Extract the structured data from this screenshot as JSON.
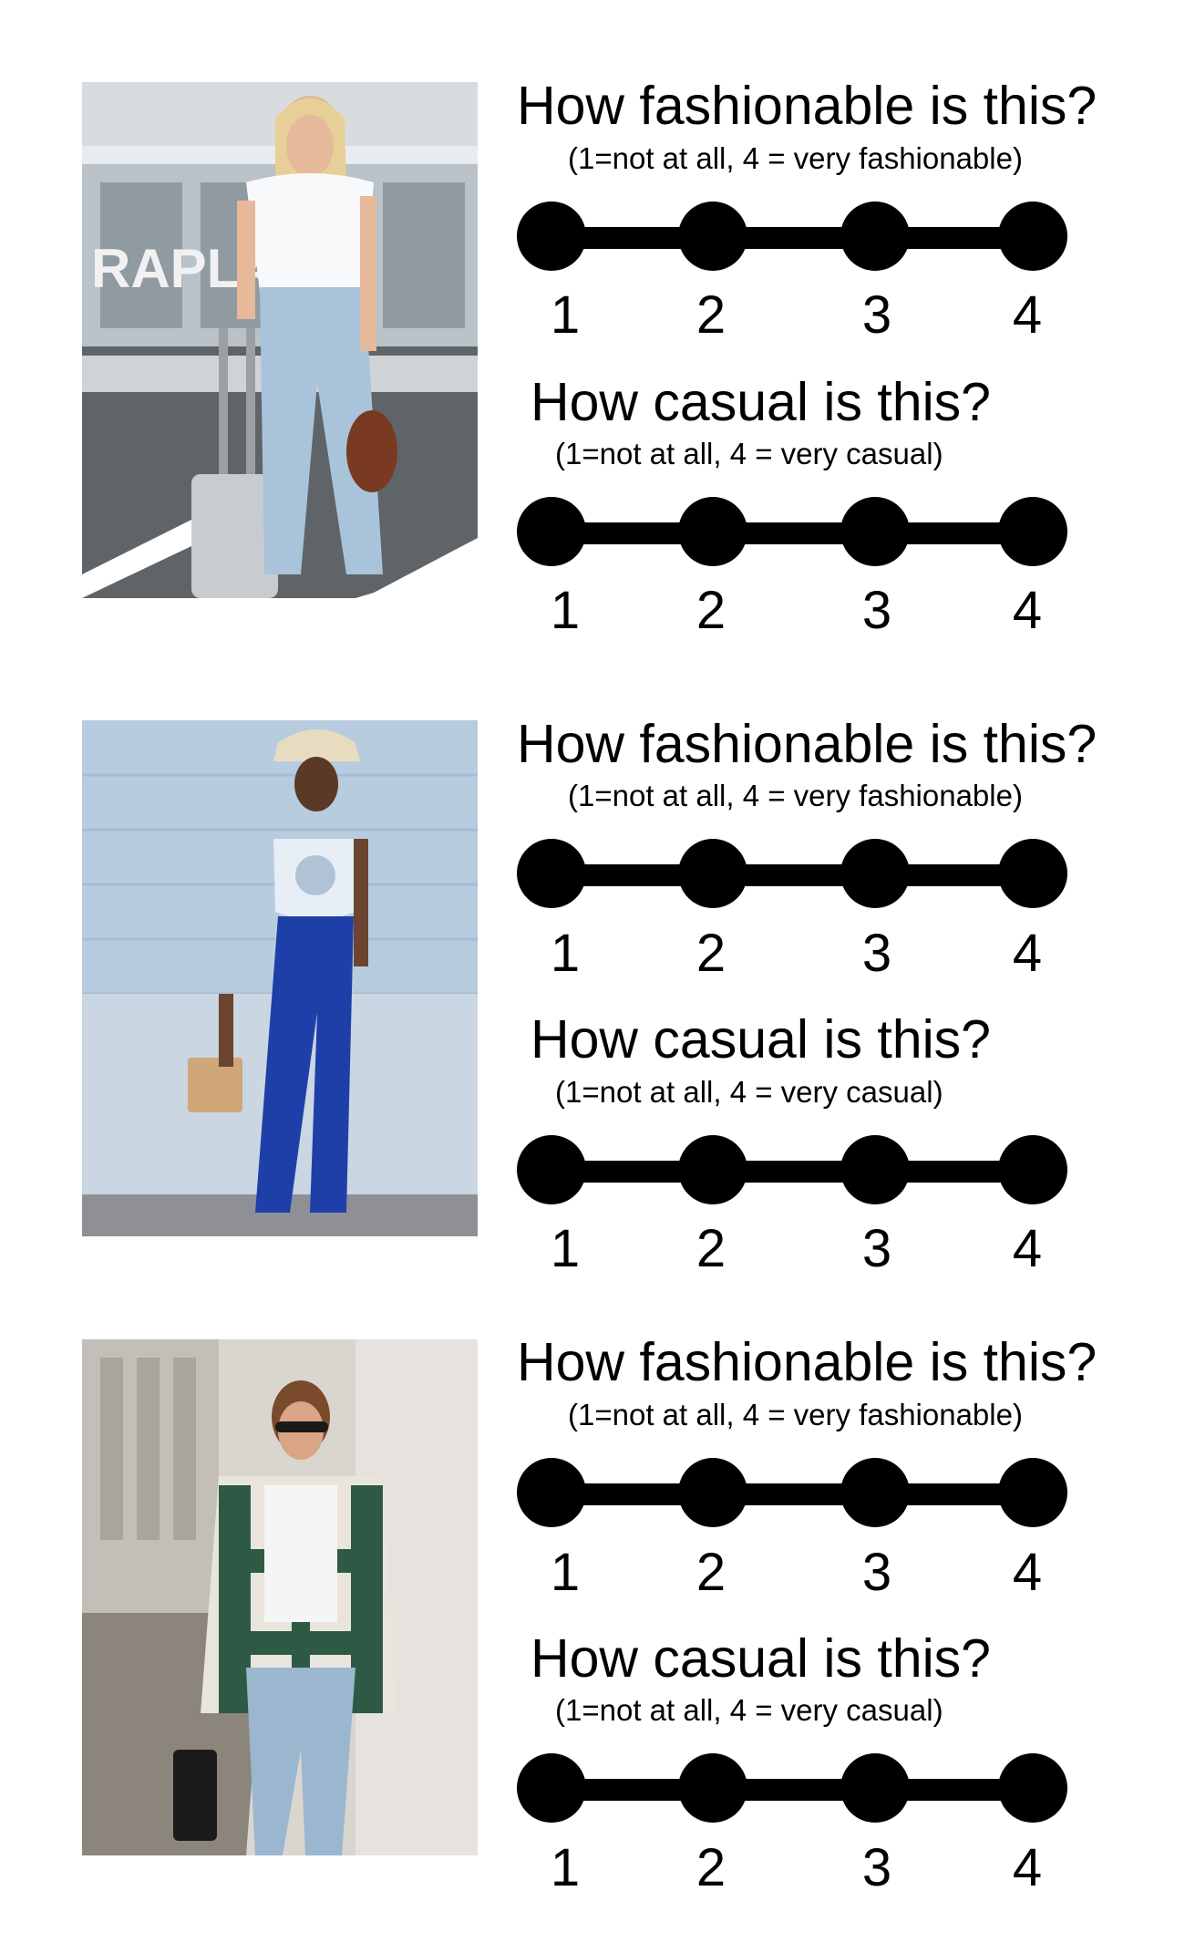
{
  "survey": [
    {
      "photo_icon": "outfit-photo-white-tee-jeans-suitcase",
      "questions": [
        {
          "title": "How fashionable is this?",
          "subtitle": "(1=not at all, 4 = very fashionable)",
          "labels": [
            "1",
            "2",
            "3",
            "4"
          ]
        },
        {
          "title": "How casual is this?",
          "subtitle": "(1=not at all, 4 = very casual)",
          "labels": [
            "1",
            "2",
            "3",
            "4"
          ]
        }
      ]
    },
    {
      "photo_icon": "outfit-photo-bandana-top-blue-jeans",
      "questions": [
        {
          "title": "How fashionable is this?",
          "subtitle": "(1=not at all, 4 = very fashionable)",
          "labels": [
            "1",
            "2",
            "3",
            "4"
          ]
        },
        {
          "title": "How casual is this?",
          "subtitle": "(1=not at all, 4 = very casual)",
          "labels": [
            "1",
            "2",
            "3",
            "4"
          ]
        }
      ]
    },
    {
      "photo_icon": "outfit-photo-plaid-shacket-jeans",
      "questions": [
        {
          "title": "How fashionable is this?",
          "subtitle": "(1=not at all, 4 = very fashionable)",
          "labels": [
            "1",
            "2",
            "3",
            "4"
          ]
        },
        {
          "title": "How casual is this?",
          "subtitle": "(1=not at all, 4 = very casual)",
          "labels": [
            "1",
            "2",
            "3",
            "4"
          ]
        }
      ]
    }
  ]
}
